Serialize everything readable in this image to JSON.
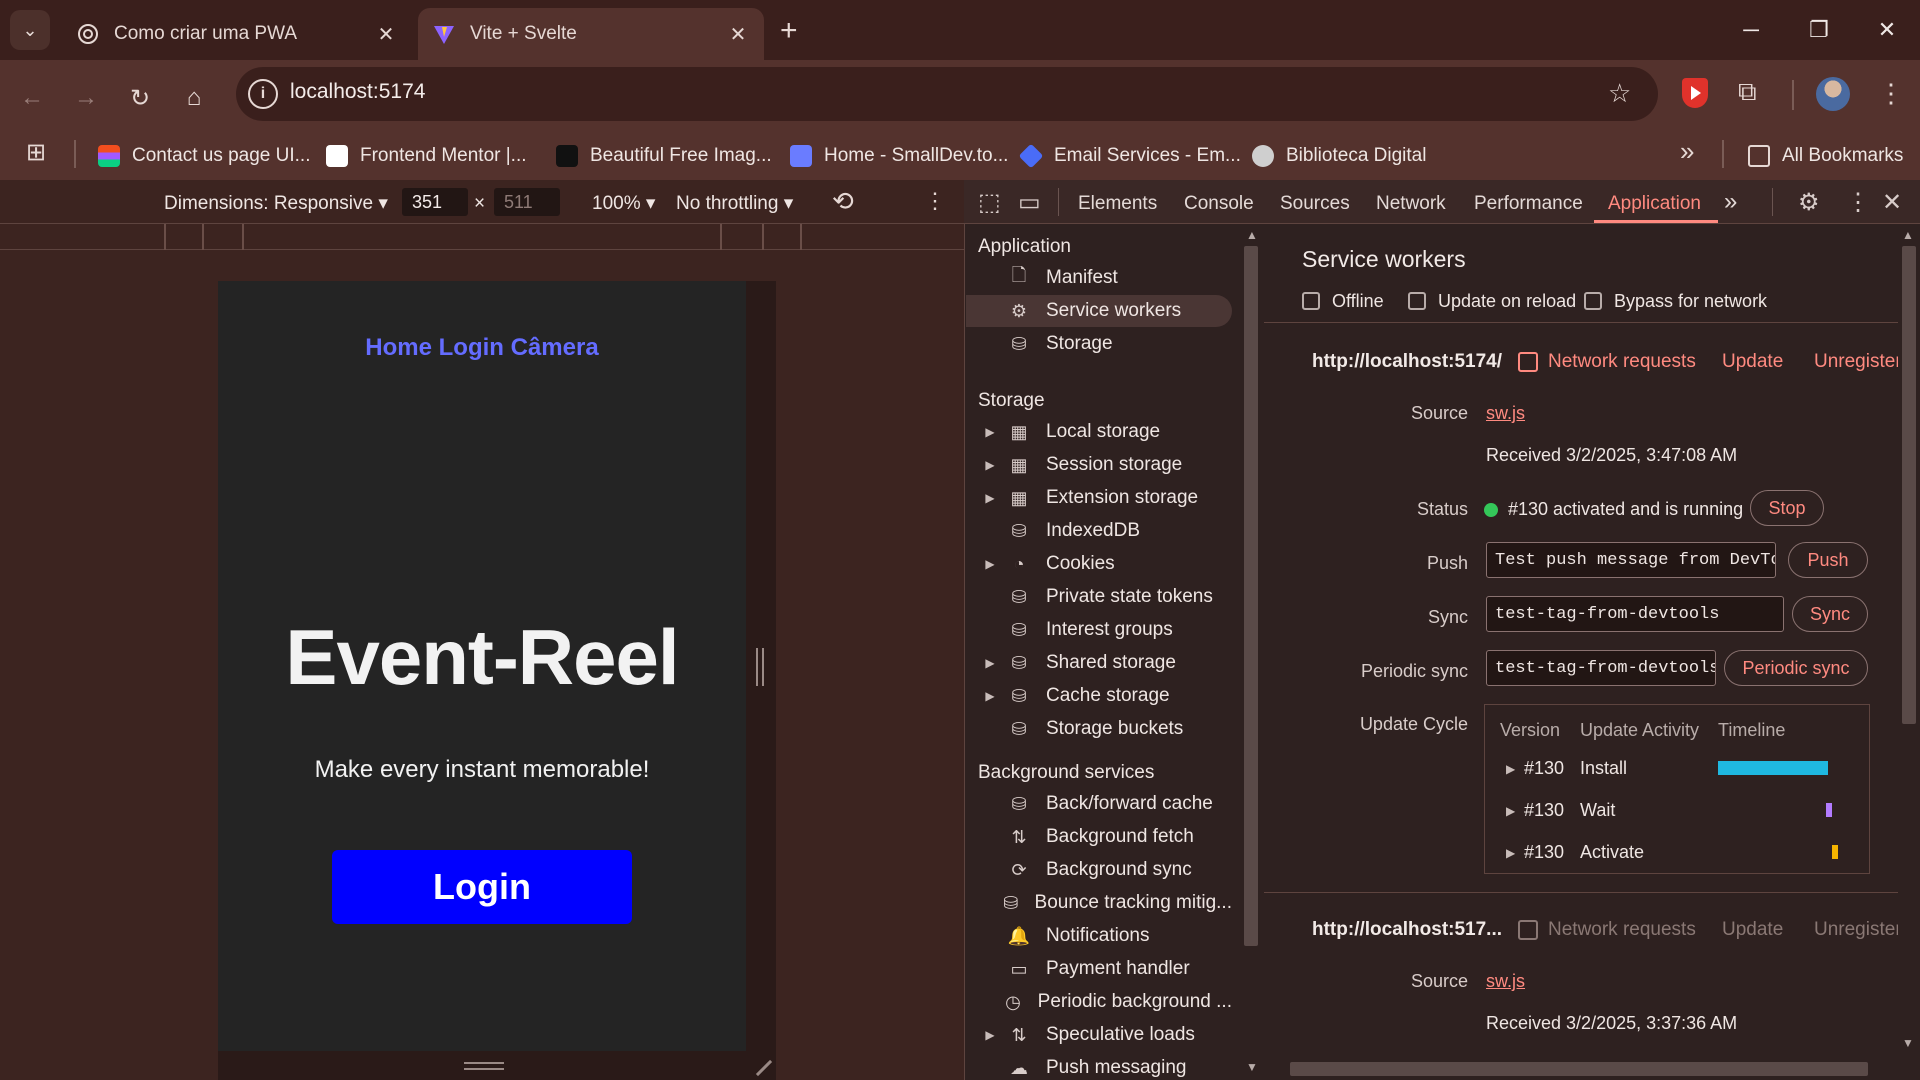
{
  "browser": {
    "tabs": [
      {
        "title": "Como criar uma PWA",
        "active": false
      },
      {
        "title": "Vite + Svelte",
        "active": true
      }
    ],
    "address": "localhost:5174",
    "bookmarks": [
      {
        "label": "Contact us page UI...",
        "color": "#f24e1e"
      },
      {
        "label": "Frontend Mentor |...",
        "color": "#ffffff"
      },
      {
        "label": "Beautiful Free Imag...",
        "color": "#111111"
      },
      {
        "label": "Home - SmallDev.to...",
        "color": "#6a7cff"
      },
      {
        "label": "Email Services - Em...",
        "color": "#4a6cf7"
      },
      {
        "label": "Biblioteca Digital",
        "color": "#cfcfcf"
      }
    ],
    "all_bookmarks": "All Bookmarks"
  },
  "device_toolbar": {
    "dimensions": "Dimensions: Responsive",
    "width": "351",
    "height_placeholder": "511",
    "zoom": "100%",
    "throttling": "No throttling"
  },
  "page": {
    "nav": "Home Login Câmera",
    "hero": "Event-Reel",
    "subtitle": "Make every instant memorable!",
    "login_button": "Login"
  },
  "devtools": {
    "tabs": [
      "Elements",
      "Console",
      "Sources",
      "Network",
      "Performance",
      "Application"
    ],
    "active_tab": "Application",
    "sidebar": {
      "application_title": "Application",
      "application": [
        "Manifest",
        "Service workers",
        "Storage"
      ],
      "storage_title": "Storage",
      "storage": [
        {
          "label": "Local storage",
          "expandable": true
        },
        {
          "label": "Session storage",
          "expandable": true
        },
        {
          "label": "Extension storage",
          "expandable": true
        },
        {
          "label": "IndexedDB",
          "expandable": false
        },
        {
          "label": "Cookies",
          "expandable": true
        },
        {
          "label": "Private state tokens",
          "expandable": false
        },
        {
          "label": "Interest groups",
          "expandable": false
        },
        {
          "label": "Shared storage",
          "expandable": true
        },
        {
          "label": "Cache storage",
          "expandable": true
        },
        {
          "label": "Storage buckets",
          "expandable": false
        }
      ],
      "background_title": "Background services",
      "background": [
        {
          "label": "Back/forward cache",
          "expandable": false
        },
        {
          "label": "Background fetch",
          "expandable": false
        },
        {
          "label": "Background sync",
          "expandable": false
        },
        {
          "label": "Bounce tracking mitig...",
          "expandable": false
        },
        {
          "label": "Notifications",
          "expandable": false
        },
        {
          "label": "Payment handler",
          "expandable": false
        },
        {
          "label": "Periodic background ...",
          "expandable": false
        },
        {
          "label": "Speculative loads",
          "expandable": true
        },
        {
          "label": "Push messaging",
          "expandable": false
        }
      ]
    },
    "service_workers": {
      "title": "Service workers",
      "options": [
        "Offline",
        "Update on reload",
        "Bypass for network"
      ],
      "workers": [
        {
          "url": "http://localhost:5174/",
          "network_requests": "Network requests",
          "update": "Update",
          "unregister": "Unregister",
          "source_label": "Source",
          "source": "sw.js",
          "received": "Received 3/2/2025, 3:47:08 AM",
          "status_label": "Status",
          "status": "#130 activated and is running",
          "stop": "Stop",
          "push_label": "Push",
          "push_value": "Test push message from DevToo",
          "push_button": "Push",
          "sync_label": "Sync",
          "sync_value": "test-tag-from-devtools",
          "sync_button": "Sync",
          "periodic_label": "Periodic sync",
          "periodic_value": "test-tag-from-devtools",
          "periodic_button": "Periodic sync",
          "cycle_label": "Update Cycle",
          "cycle_headers": [
            "Version",
            "Update Activity",
            "Timeline"
          ],
          "cycle_rows": [
            {
              "version": "#130",
              "activity": "Install",
              "color": "#1fb8e0"
            },
            {
              "version": "#130",
              "activity": "Wait",
              "color": "#b37cff"
            },
            {
              "version": "#130",
              "activity": "Activate",
              "color": "#f5b400"
            }
          ]
        },
        {
          "url": "http://localhost:517...",
          "network_requests": "Network requests",
          "update": "Update",
          "unregister": "Unregister",
          "source_label": "Source",
          "source": "sw.js",
          "received": "Received 3/2/2025, 3:37:36 AM"
        }
      ]
    }
  }
}
